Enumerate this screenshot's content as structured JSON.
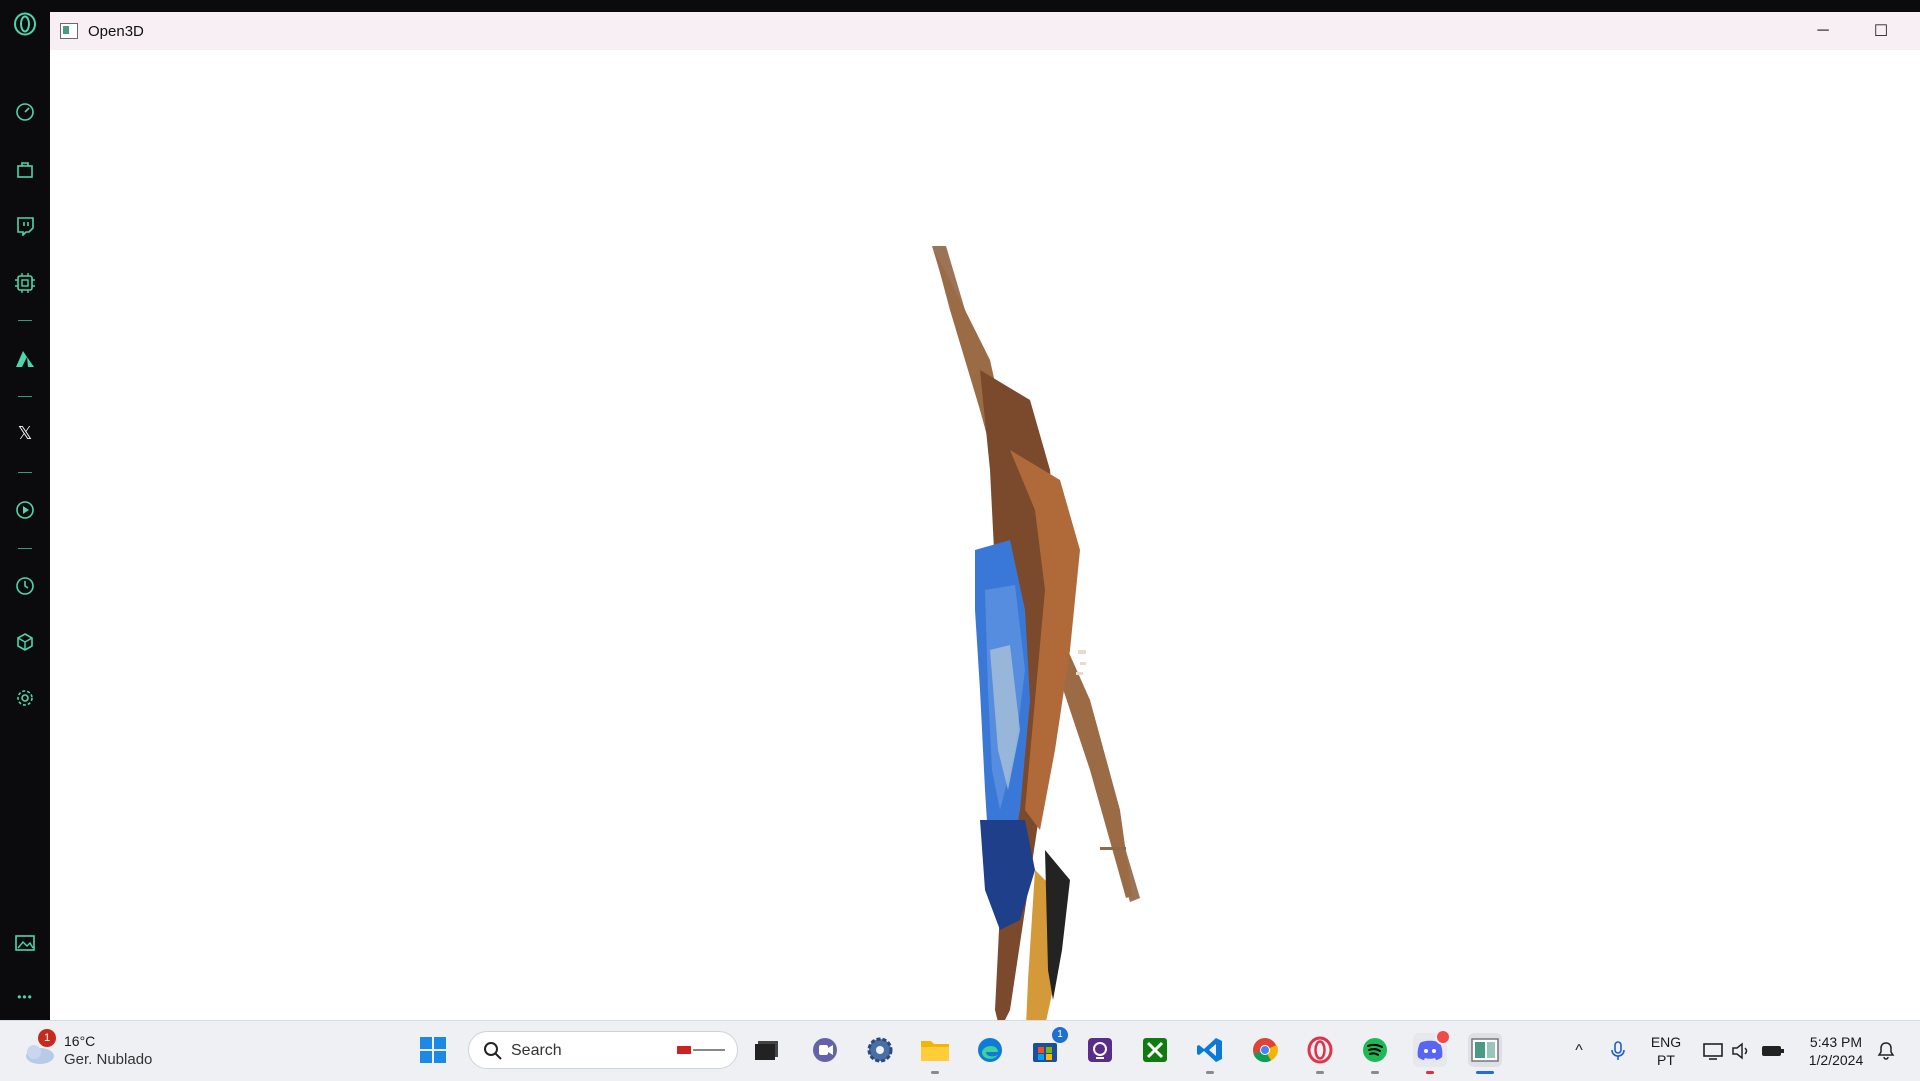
{
  "window": {
    "title": "Open3D",
    "minimize_glyph": "─",
    "maximize_glyph": "☐"
  },
  "sidebar": {
    "items": [
      {
        "name": "opera-logo-icon"
      },
      {
        "name": "speed-dial-icon"
      },
      {
        "name": "shop-icon"
      },
      {
        "name": "twitch-icon"
      },
      {
        "name": "gx-control-icon"
      },
      {
        "name": "aria-icon"
      },
      {
        "name": "x-twitter-icon"
      },
      {
        "name": "player-icon"
      },
      {
        "name": "history-icon"
      },
      {
        "name": "extensions-cube-icon"
      },
      {
        "name": "settings-gear-icon"
      },
      {
        "name": "wallpaper-icon"
      },
      {
        "name": "more-icon"
      }
    ],
    "more_label": "•••",
    "x_label": "𝕏"
  },
  "taskbar": {
    "weather": {
      "temp": "16°C",
      "desc": "Ger. Nublado",
      "badge": "1"
    },
    "search": {
      "label": "Search"
    },
    "apps": [
      {
        "name": "start-icon"
      },
      {
        "name": "task-view-icon"
      },
      {
        "name": "teams-icon"
      },
      {
        "name": "settings-icon"
      },
      {
        "name": "file-explorer-icon"
      },
      {
        "name": "edge-icon"
      },
      {
        "name": "microsoft-store-icon",
        "badge": "1"
      },
      {
        "name": "app-icon"
      },
      {
        "name": "xbox-icon"
      },
      {
        "name": "vscode-icon"
      },
      {
        "name": "chrome-icon"
      },
      {
        "name": "opera-gx-icon"
      },
      {
        "name": "spotify-icon"
      },
      {
        "name": "discord-icon"
      },
      {
        "name": "open3d-taskbar-icon"
      }
    ],
    "tray": {
      "chevron": "^",
      "lang_line1": "ENG",
      "lang_line2": "PT",
      "time": "5:43 PM",
      "date": "1/2/2024"
    }
  },
  "colors": {
    "accent": "#4dd6a8",
    "sidebar_bg": "#0b0b0d",
    "titlebar_bg": "#f8eff4",
    "taskbar_bg": "#eef0f4"
  }
}
